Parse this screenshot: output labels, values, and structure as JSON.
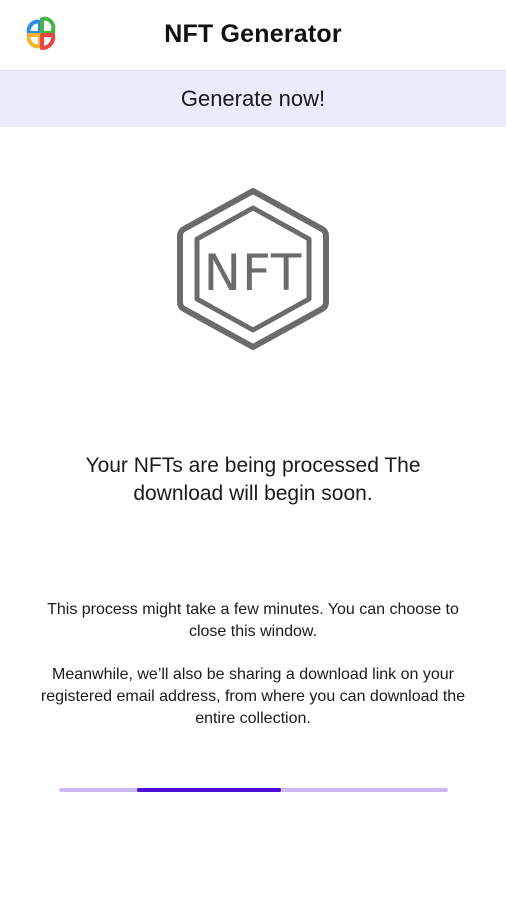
{
  "header": {
    "title": "NFT Generator",
    "logo_icon": "app-logo-icon"
  },
  "generate_button": {
    "label": "Generate now!"
  },
  "nft_badge": {
    "icon": "nft-hexagon-icon",
    "label": "NFT"
  },
  "status": {
    "title": "Your NFTs are being processed The download will begin soon."
  },
  "info": {
    "paragraph_1": "This process might take a few minutes. You can choose to close this window.",
    "paragraph_2": "Meanwhile, we’ll also be sharing a download link on your registered email address, from where you can download the entire collection."
  },
  "progress": {
    "indeterminate_segment_start": 0.2,
    "indeterminate_segment_end": 0.57
  },
  "colors": {
    "header_bg": "#ffffff",
    "generate_bar_bg": "#e8ecfb",
    "progress_track": "#cdb8f5",
    "progress_fill": "#4a10d8",
    "icon_stroke": "#6b6b6b"
  }
}
